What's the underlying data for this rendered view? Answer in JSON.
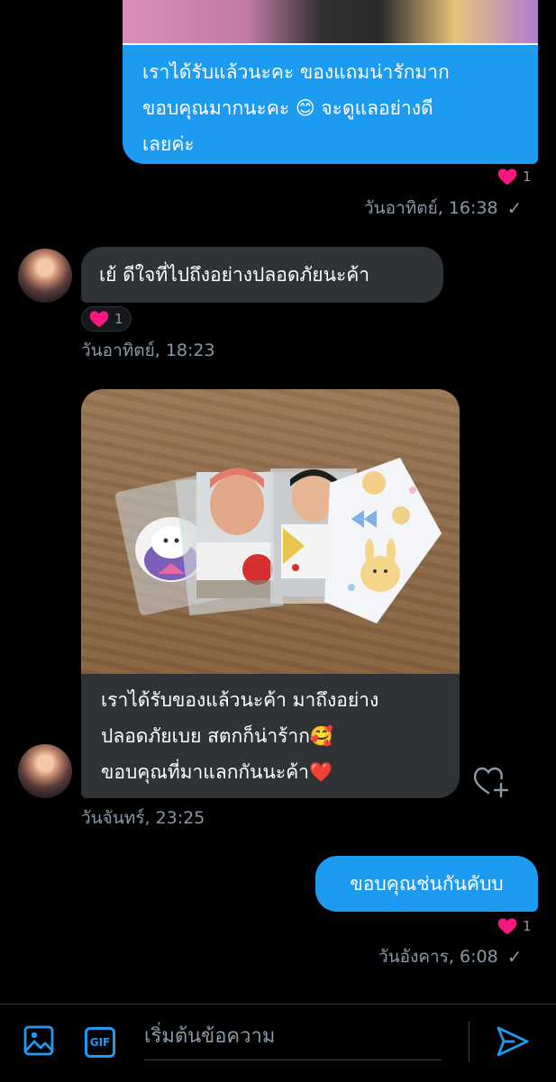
{
  "messages": {
    "m1": {
      "text": "เราได้รับแล้วนะคะ ของแถมน่ารักมาก\nขอบคุณมากนะคะ 😊 จะดูแลอย่างดี\nเลยค่ะ",
      "reaction_count": "1",
      "timestamp": "วันอาทิตย์, 16:38",
      "status": "✓"
    },
    "m2": {
      "text": "เย้ ดีใจที่ไปถึงอย่างปลอดภัยนะค้า",
      "reaction_count": "1",
      "timestamp": "วันอาทิตย์, 18:23"
    },
    "m3": {
      "text": "เราได้รับของแล้วนะค้า มาถึงอย่าง\nปลอดภัยเบย สตกก็น่าร้าก🥰\nขอบคุณที่มาแลกกันนะค้า❤️",
      "timestamp": "วันจันทร์, 23:25"
    },
    "m4": {
      "text": "ขอบคุณช่นกันคับบ",
      "reaction_count": "1",
      "timestamp": "วันอังคาร, 6:08",
      "status": "✓"
    }
  },
  "composer": {
    "placeholder": "เริ่มต้นข้อความ",
    "gif_label": "GIF"
  },
  "colors": {
    "accent": "#1d9bf0",
    "heart": "#f91880",
    "incoming_bubble": "#2f3336"
  },
  "icons": [
    "heart-icon",
    "check-icon",
    "add-reaction-icon",
    "image-icon",
    "gif-icon",
    "send-icon"
  ]
}
